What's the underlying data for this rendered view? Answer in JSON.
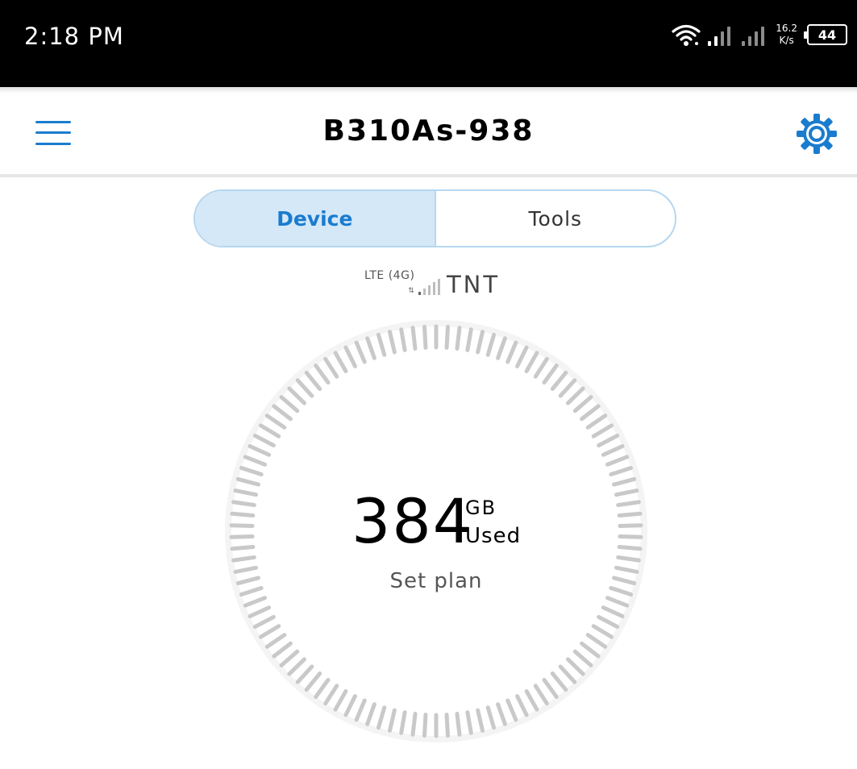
{
  "status_bar": {
    "time": "2:18 PM",
    "speed_value": "16.2",
    "speed_unit": "K/s",
    "battery": "44"
  },
  "header": {
    "title": "B310As-938",
    "menu_icon": "hamburger-menu-icon",
    "settings_icon": "gear-icon"
  },
  "tabs": [
    {
      "label": "Device",
      "active": true
    },
    {
      "label": "Tools",
      "active": false
    }
  ],
  "network": {
    "type": "LTE (4G)",
    "carrier": "TNT",
    "signal_icon": "signal-strength-icon"
  },
  "usage": {
    "value": "384",
    "unit": "GB",
    "label": "Used",
    "action": "Set plan"
  },
  "colors": {
    "accent": "#1a7ccf",
    "tab_active_bg": "#d4e8f8",
    "gauge_tick": "#c9c9c9"
  }
}
